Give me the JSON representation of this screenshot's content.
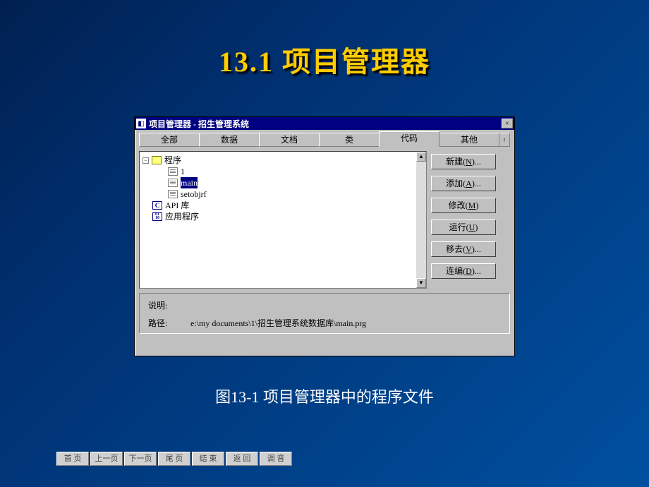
{
  "slide": {
    "title": "13.1  项目管理器",
    "caption": "图13-1  项目管理器中的程序文件"
  },
  "window": {
    "title": "项目管理器 - 招生管理系统",
    "close": "×"
  },
  "tabs": {
    "items": [
      {
        "label": "全部"
      },
      {
        "label": "数据"
      },
      {
        "label": "文档"
      },
      {
        "label": "类"
      },
      {
        "label": "代码"
      },
      {
        "label": "其他"
      }
    ],
    "arrow": "↑"
  },
  "tree": {
    "nodes": [
      {
        "expander": "−",
        "icon": "folder",
        "label": "程序",
        "indent": 0
      },
      {
        "icon": "file",
        "label": "1",
        "indent": 1
      },
      {
        "icon": "file",
        "label": "main",
        "indent": 1,
        "selected": true
      },
      {
        "icon": "file",
        "label": "setobjrf",
        "indent": 1
      },
      {
        "icon": "c",
        "label": "API 库",
        "indent": 0,
        "iconText": "C"
      },
      {
        "icon": "app",
        "label": "应用程序",
        "indent": 0,
        "iconText": "01\n10"
      }
    ],
    "scroll": {
      "up": "▲",
      "down": "▼"
    }
  },
  "buttons": [
    {
      "label": "新建",
      "key": "N",
      "suffix": "..."
    },
    {
      "label": "添加",
      "key": "A",
      "suffix": "..."
    },
    {
      "label": "修改",
      "key": "M",
      "suffix": ""
    },
    {
      "label": "运行",
      "key": "U",
      "suffix": ""
    },
    {
      "label": "移去",
      "key": "V",
      "suffix": "..."
    },
    {
      "label": "连编",
      "key": "D",
      "suffix": "..."
    }
  ],
  "description": {
    "label1": "说明:",
    "label2": "路径:",
    "path": "e:\\my documents\\1\\招生管理系统数据库\\main.prg"
  },
  "nav": [
    "首 页",
    "上一页",
    "下一页",
    "尾 页",
    "结 束",
    "返 回",
    "调 音"
  ]
}
